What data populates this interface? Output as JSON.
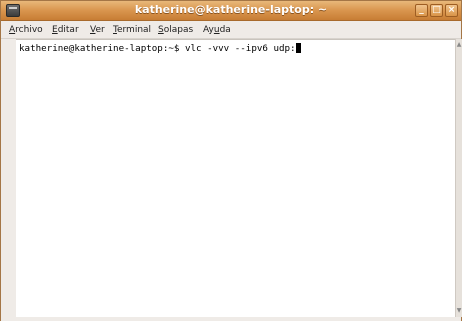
{
  "window": {
    "title": "katherine@katherine-laptop: ~"
  },
  "menubar": {
    "items": [
      {
        "first": "A",
        "rest": "rchivo"
      },
      {
        "first": "E",
        "rest": "ditar"
      },
      {
        "first": "V",
        "rest": "er"
      },
      {
        "first": "T",
        "rest": "erminal"
      },
      {
        "first": "S",
        "rest": "olapas"
      },
      {
        "first": "Ay",
        "u": "u",
        "rest": "da"
      }
    ]
  },
  "terminal": {
    "prompt": "katherine@katherine-laptop:~$ ",
    "command": "vlc -vvv --ipv6 udp:"
  },
  "icons": {
    "minimize": "minimize-icon",
    "maximize": "maximize-icon",
    "close": "close-icon",
    "app": "terminal-app-icon"
  }
}
